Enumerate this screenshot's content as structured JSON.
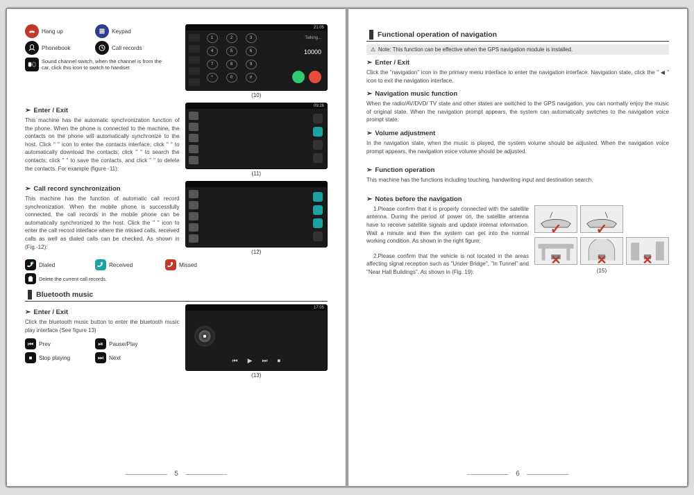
{
  "left": {
    "icons": {
      "hangup": "Hang up",
      "keypad": "Keypad",
      "phonebook": "Phonebook",
      "callrecords": "Call records",
      "soundchannel": "Sound channel switch, when the channel is from the car, click this icon to switch to handset"
    },
    "enter_exit_title": "Enter / Exit",
    "enter_exit_text": "This machine has the automatic synchronization function of the phone. When the phone is connected to the machine, the contacts on the phone will automatically synchronize to the host. Click \"  \" icon to enter the contacts interface; click \"  \" to automatically download the contacts; click \"  \" to search the contacts; click \"  \" to save the contacts, and click \"  \" to delete the contacts. For example (figure -11):",
    "callrec_title": "Call record synchronization",
    "callrec_text": "This machine has the function of automatic call record synchronization. When the mobile phone is successfully connected, the call records in the mobile phone can be automatically synchronized to the host. Click the \"  \" icon to enter the call record interface where the missed calls, received calls as well as dialed calls can be checked. As shown in (Fig.-12):",
    "dialed": "Dialed",
    "received": "Received",
    "missed": "Missed",
    "delete_calls": "Delete the current call records.",
    "bt_music_title": "Bluetooth music",
    "bt_enter_exit": "Enter / Exit",
    "bt_text": "Click the bluetooth music button to enter the bluetooth music play interface (See figure 13)",
    "prev": "Prev",
    "pauseplay": "Pause/Play",
    "stop": "Stop playing",
    "next": "Next",
    "cap10": "(10)",
    "cap11": "(11)",
    "cap12": "(12)",
    "cap13": "(13)",
    "pagenum": "5",
    "dialnum": "10000",
    "talking": "Talking..."
  },
  "right": {
    "main_title": "Functional operation of navigation",
    "note": "Note: This function can be effective when the GPS navigation module is installed.",
    "enter_exit": "Enter / Exit",
    "ee_text": "Click the \"navigation\" icon in the primary menu interface to enter the navigation interface. Navigation state, click the \" ◀ \" icon to exit the navigation interface.",
    "navmusic": "Navigation music function",
    "navmusic_text": "When the radio/AV/DVD/ TV state and other states are switched to the GPS navigation, you can normally enjoy the music of original state. When the navigation prompt appears, the system can automatically switches to the navigation voice prompt state.",
    "vol": "Volume adjustment",
    "vol_text": "In the navigation state, when the music is played, the system volume should be adjusted. When the navigation voice prompt appears, the navigation voice volume should be adjusted.",
    "funcop": "Function operation",
    "funcop_text": "This machine has the functions including touching, handwriting input and destination search.",
    "notes": "Notes before the navigation",
    "note1": "1.Please confirm that it is properly connected with the satellite antenna. During the period of power on, the satellite antenna have to receive satellite signals and update internal information. Wait a minute and then the system can get into the normal working condition. As shown in the right figure:",
    "note2": "2.Please confirm that the vehicle is not located in the areas affecting signal reception such as \"Under Bridge\", \"In Tunnel\" and \"Near Hall Buildings\". As shown in (Fig. 19):",
    "cap15": "(15)",
    "pagenum": "6"
  }
}
